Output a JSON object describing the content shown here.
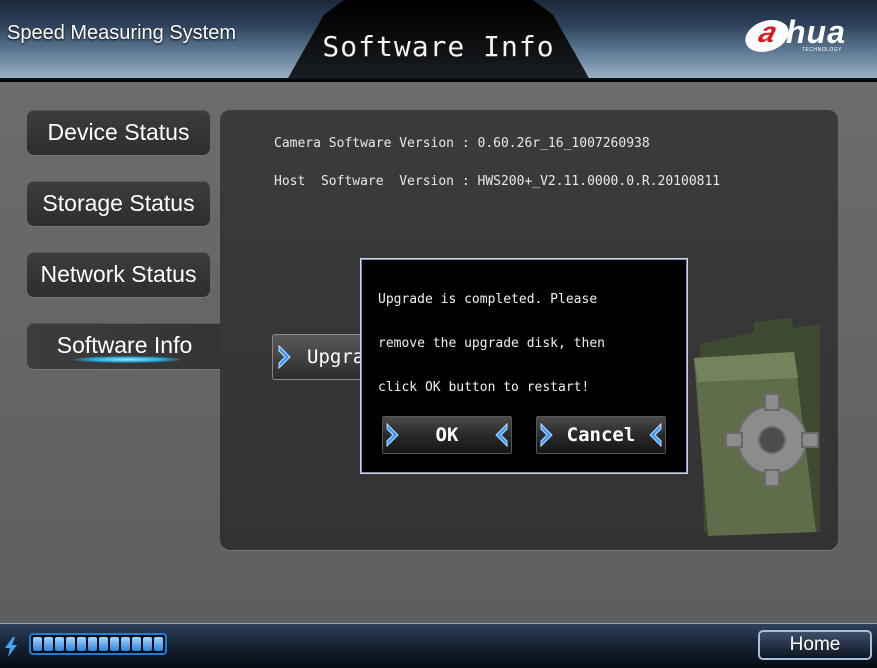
{
  "header": {
    "app_title": "Speed Measuring System",
    "page_heading": "Software Info",
    "brand": {
      "badge_text": "a",
      "rest_text": "hua",
      "sub_text": "TECHNOLOGY",
      "badge_color": "#d71a20"
    }
  },
  "sidebar": {
    "items": [
      {
        "label": "Device Status",
        "active": false
      },
      {
        "label": "Storage Status",
        "active": false
      },
      {
        "label": "Network Status",
        "active": false
      },
      {
        "label": "Software Info",
        "active": true
      }
    ]
  },
  "software_info": {
    "camera_line": "Camera Software Version : 0.60.26r_16_1007260938",
    "host_line": "Host  Software  Version : HWS200+_V2.11.0000.0.R.20100811",
    "upgrade_button_label": "Upgrade"
  },
  "dialog": {
    "message_lines": [
      "Upgrade is completed. Please",
      "remove the upgrade disk, then",
      "click OK button to restart!"
    ],
    "ok_label": "OK",
    "cancel_label": "Cancel"
  },
  "footer": {
    "progress_fraction": 1.0,
    "home_label": "Home"
  },
  "colors": {
    "accent_blue": "#29a9e0",
    "progress_blue": "#2a86e0",
    "dialog_border": "#7a90ac"
  },
  "icons": [
    "bolt-icon",
    "chevron-right-icon",
    "chevron-left-icon",
    "folder-gear-icon"
  ]
}
